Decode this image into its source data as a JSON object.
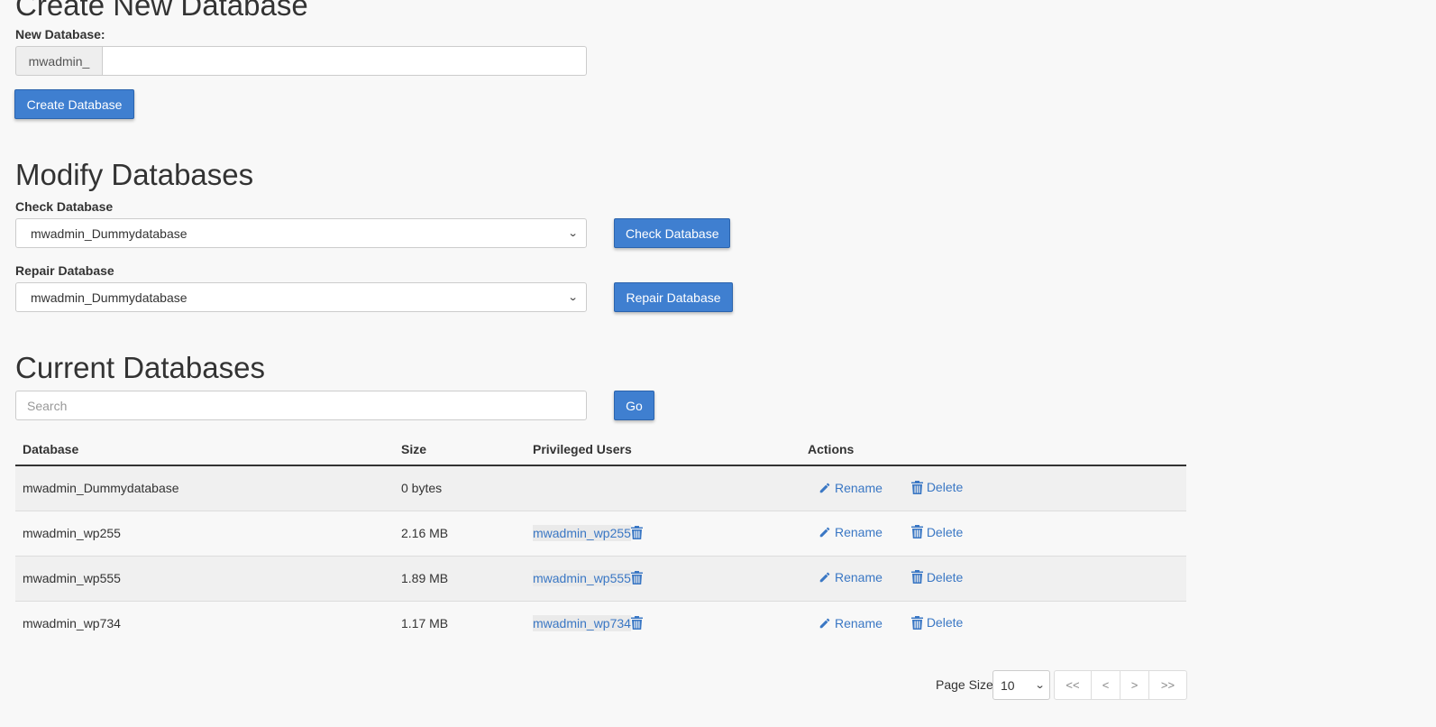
{
  "create_section": {
    "title": "Create New Database",
    "field_label": "New Database:",
    "prefix": "mwadmin_",
    "input_value": "",
    "button_label": "Create Database"
  },
  "modify_section": {
    "title": "Modify Databases",
    "check_label": "Check Database",
    "check_selected": "mwadmin_Dummydatabase",
    "check_button": "Check Database",
    "repair_label": "Repair Database",
    "repair_selected": "mwadmin_Dummydatabase",
    "repair_button": "Repair Database"
  },
  "current_section": {
    "title": "Current Databases",
    "search_placeholder": "Search",
    "go_button": "Go",
    "columns": [
      "Database",
      "Size",
      "Privileged Users",
      "Actions"
    ],
    "rows": [
      {
        "database": "mwadmin_Dummydatabase",
        "size": "0 bytes",
        "user": ""
      },
      {
        "database": "mwadmin_wp255",
        "size": "2.16 MB",
        "user": "mwadmin_wp255"
      },
      {
        "database": "mwadmin_wp555",
        "size": "1.89 MB",
        "user": "mwadmin_wp555"
      },
      {
        "database": "mwadmin_wp734",
        "size": "1.17 MB",
        "user": "mwadmin_wp734"
      }
    ],
    "actions": {
      "rename": "Rename",
      "delete": "Delete"
    }
  },
  "pagination": {
    "page_size_label": "Page Size",
    "page_size": "10",
    "first": "<<",
    "prev": "<",
    "next": ">",
    "last": ">>"
  },
  "colors": {
    "primary_button": "#3f7fd0",
    "link": "#3a77c4",
    "background": "#f8f8f8"
  }
}
